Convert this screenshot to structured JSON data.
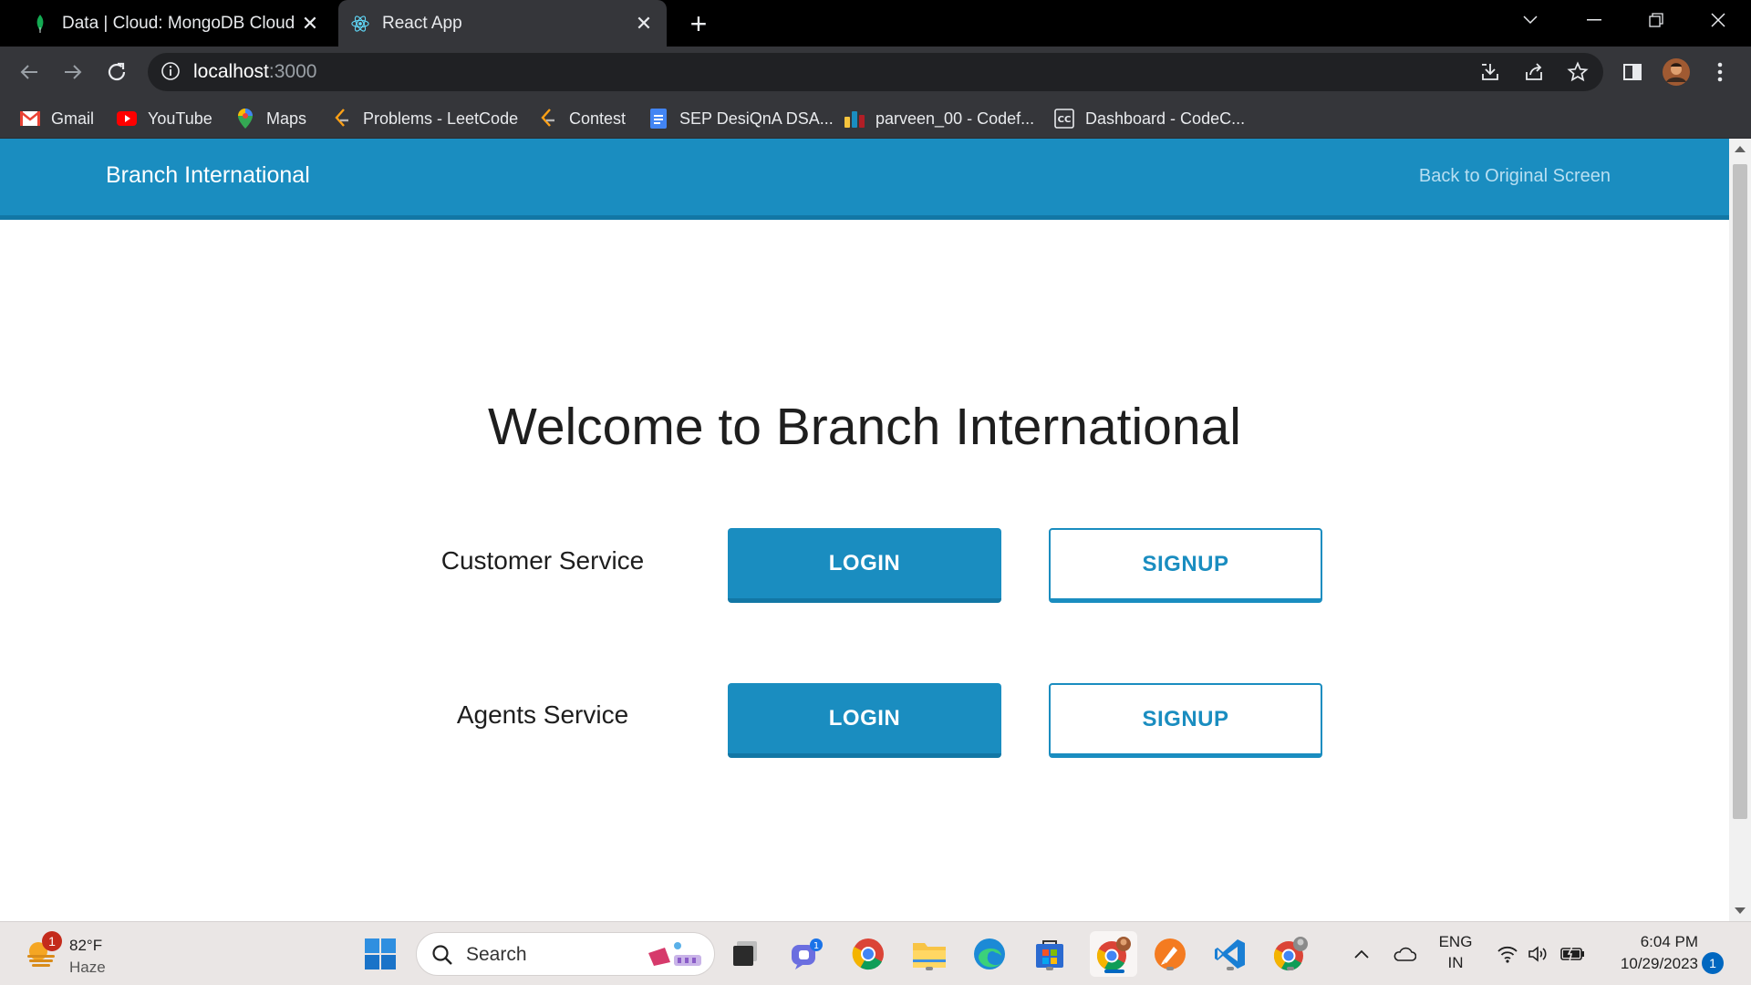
{
  "browser": {
    "tabs": [
      {
        "title": "Data | Cloud: MongoDB Cloud",
        "favicon": "mongodb-leaf-icon",
        "active": false
      },
      {
        "title": "React App",
        "favicon": "react-atom-icon",
        "active": true
      }
    ],
    "close_glyph": "✕",
    "new_tab_glyph": "+",
    "address": {
      "host": "localhost",
      "port": ":3000"
    },
    "bookmarks": [
      {
        "label": "Gmail",
        "icon": "gmail-icon"
      },
      {
        "label": "YouTube",
        "icon": "youtube-icon"
      },
      {
        "label": "Maps",
        "icon": "maps-icon"
      },
      {
        "label": "Problems - LeetCode",
        "icon": "leetcode-icon"
      },
      {
        "label": "Contest",
        "icon": "leetcode-icon"
      },
      {
        "label": "SEP DesiQnA DSA...",
        "icon": "docs-icon"
      },
      {
        "label": "parveen_00 - Codef...",
        "icon": "codeforces-icon"
      },
      {
        "label": "Dashboard - CodeC...",
        "icon": "codechef-icon"
      }
    ]
  },
  "app": {
    "brand": "Branch International",
    "back_link": "Back to Original Screen",
    "welcome": "Welcome to Branch International",
    "services": [
      {
        "label": "Customer Service",
        "login": "LOGIN",
        "signup": "SIGNUP"
      },
      {
        "label": "Agents Service",
        "login": "LOGIN",
        "signup": "SIGNUP"
      }
    ],
    "colors": {
      "primary": "#1a8dc0",
      "primary_dark": "#1277a5"
    }
  },
  "taskbar": {
    "weather": {
      "temp": "82°F",
      "condition": "Haze",
      "badge": "1"
    },
    "search_placeholder": "Search",
    "teams_badge": "1",
    "lang_line1": "ENG",
    "lang_line2": "IN",
    "time": "6:04 PM",
    "date": "10/29/2023",
    "notification_count": "1"
  }
}
